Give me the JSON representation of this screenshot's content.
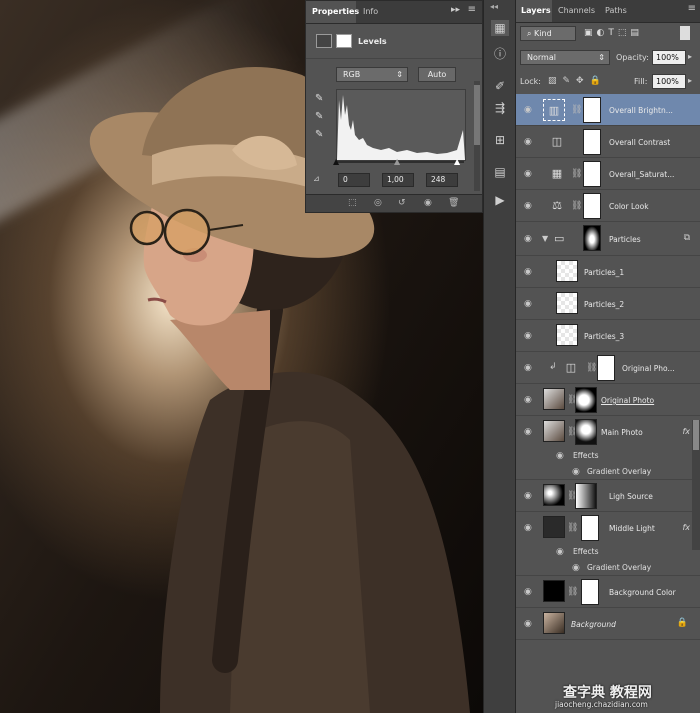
{
  "properties_panel": {
    "tabs": [
      "Properties",
      "Info"
    ],
    "adjustment_title": "Levels",
    "channel": "RGB",
    "auto_label": "Auto",
    "input_black": "0",
    "input_gamma": "1,00",
    "input_white": "248"
  },
  "layers_panel": {
    "tabs": [
      "Layers",
      "Channels",
      "Paths"
    ],
    "filter_kind": "Kind",
    "blend_mode": "Normal",
    "opacity_label": "Opacity:",
    "opacity_value": "100%",
    "lock_label": "Lock:",
    "fill_label": "Fill:",
    "fill_value": "100%",
    "layers": [
      {
        "name": "Overall Brightn...",
        "selected": true
      },
      {
        "name": "Overall Contrast"
      },
      {
        "name": "Overall_Saturat..."
      },
      {
        "name": "Color Look"
      },
      {
        "name": "Particles"
      },
      {
        "name": "Particles_1"
      },
      {
        "name": "Particles_2"
      },
      {
        "name": "Particles_3"
      },
      {
        "name": "Original Pho..."
      },
      {
        "name": "Original Photo"
      },
      {
        "name": "Main Photo"
      },
      {
        "name": "Ligh Source"
      },
      {
        "name": "Middle Light"
      },
      {
        "name": "Background Color"
      },
      {
        "name": "Background"
      }
    ],
    "effects_label": "Effects",
    "gradient_overlay_label": "Gradient Overlay",
    "fx_label": "fx"
  },
  "watermark": {
    "main": "查字典 教程网",
    "url": "jiaocheng.chazidian.com"
  }
}
